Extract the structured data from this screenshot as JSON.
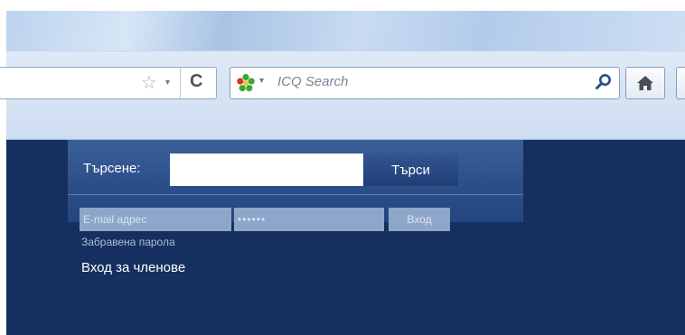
{
  "browser": {
    "search_placeholder": "ICQ Search",
    "icons": [
      "star-icon",
      "reload-icon",
      "icq-flower-icon",
      "magnifier-icon",
      "home-icon"
    ],
    "colors": {
      "chrome": "#d2e1f3",
      "icq_green": "#3aa832",
      "icq_red": "#d9312b"
    }
  },
  "page": {
    "search": {
      "label": "Търсене:",
      "value": "",
      "button": "Търси"
    },
    "login": {
      "email_placeholder": "E-mail адрес",
      "password_value": "••••••",
      "button": "Вход",
      "forgot": "Забравена парола"
    },
    "members_title": "Вход за членове",
    "colors": {
      "background": "#15305f",
      "panel": "#2c4f8a",
      "field": "#8ea6c9"
    }
  }
}
